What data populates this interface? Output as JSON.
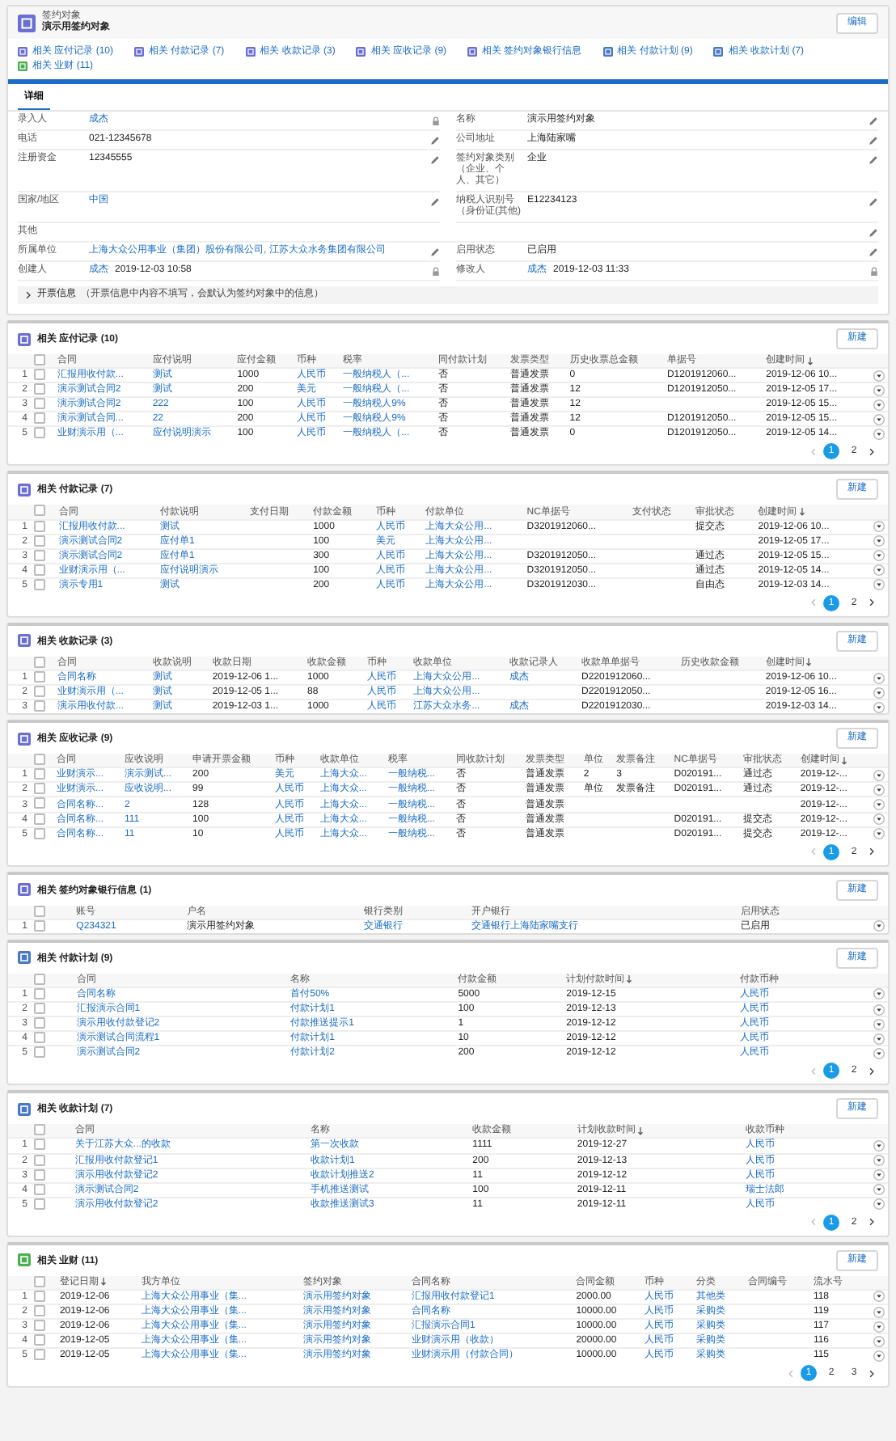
{
  "header": {
    "object_type": "签约对象",
    "title": "演示用签约对象",
    "edit_button": "编辑"
  },
  "related_links": [
    {
      "label": "相关 应付记录 (10)",
      "color": "#6b6fd4"
    },
    {
      "label": "相关 付款记录 (7)",
      "color": "#6b6fd4"
    },
    {
      "label": "相关 收款记录 (3)",
      "color": "#6b6fd4"
    },
    {
      "label": "相关 应收记录 (9)",
      "color": "#6b6fd4"
    },
    {
      "label": "相关 签约对象银行信息",
      "color": "#6b6fd4"
    },
    {
      "label": "相关 付款计划 (9)",
      "color": "#4a78c8"
    },
    {
      "label": "相关 收款计划 (7)",
      "color": "#4a78c8"
    },
    {
      "label": "相关 业财 (11)",
      "color": "#4caf50"
    }
  ],
  "tabs": [
    {
      "label": "详细",
      "selected": true
    }
  ],
  "fields": [
    {
      "label": "录入人",
      "value": "成杰",
      "kind": "link",
      "locked": true
    },
    {
      "label": "名称",
      "value": "演示用签约对象",
      "kind": "text",
      "locked": false
    },
    {
      "label": "电话",
      "value": "021-12345678",
      "kind": "text",
      "locked": false
    },
    {
      "label": "公司地址",
      "value": "上海陆家嘴",
      "kind": "text",
      "locked": false
    },
    {
      "label": "注册资金",
      "value": "12345555",
      "kind": "text",
      "locked": false
    },
    {
      "label": "签约对象类别（企业、个人、其它）",
      "value": "企业",
      "kind": "text",
      "locked": false
    },
    {
      "label": "国家/地区",
      "value": "中国",
      "kind": "link",
      "locked": false
    },
    {
      "label": "纳税人识别号（身份证(其他)",
      "value": "E12234123",
      "kind": "text",
      "locked": false
    },
    {
      "label": "其他",
      "kind": "wide",
      "locked": false
    },
    {
      "label": "所属单位",
      "value": "上海大众公用事业（集团）股份有限公司, 江苏大众水务集团有限公司",
      "kind": "link",
      "locked": false
    },
    {
      "label": "启用状态",
      "value": "已启用",
      "kind": "text",
      "locked": false
    },
    {
      "label": "创建人",
      "value": "成杰",
      "extra": "2019-12-03 10:58",
      "kind": "link",
      "locked": true
    },
    {
      "label": "修改人",
      "value": "成杰",
      "extra": "2019-12-03 11:33",
      "kind": "link",
      "locked": true
    }
  ],
  "collapsible": {
    "label": "开票信息",
    "note": "（开票信息中内容不填写，会默认为签约对象中的信息）",
    "expanded": false
  },
  "tables": [
    {
      "title": "相关 应付记录 (10)",
      "color": "#6b6fd4",
      "new_button": "新建",
      "select_all": false,
      "columns": [
        {
          "label": "合同",
          "link": true,
          "sorted": false
        },
        {
          "label": "应付说明",
          "link": true,
          "sorted": false
        },
        {
          "label": "应付金额",
          "link": false,
          "sorted": false
        },
        {
          "label": "币种",
          "link": true,
          "sorted": false
        },
        {
          "label": "税率",
          "link": true,
          "sorted": false
        },
        {
          "label": "同付款计划",
          "link": false,
          "sorted": false
        },
        {
          "label": "发票类型",
          "link": false,
          "sorted": false
        },
        {
          "label": "历史收票总金额",
          "link": false,
          "sorted": false
        },
        {
          "label": "单据号",
          "link": false,
          "sorted": false
        },
        {
          "label": "创建时间",
          "link": false,
          "sorted": true
        }
      ],
      "rows": [
        {
          "no": "1",
          "checked": false,
          "cells": [
            "汇报用收付款...",
            "测试",
            "1000",
            "人民币",
            "一般纳税人（...",
            "否",
            "普通发票",
            "0",
            "D1201912060...",
            "2019-12-06 10..."
          ]
        },
        {
          "no": "2",
          "checked": false,
          "cells": [
            "演示测试合同2",
            "测试",
            "200",
            "美元",
            "一般纳税人（...",
            "否",
            "普通发票",
            "12",
            "D1201912050...",
            "2019-12-05 17..."
          ]
        },
        {
          "no": "3",
          "checked": false,
          "cells": [
            "演示测试合同2",
            "222",
            "100",
            "人民币",
            "一般纳税人9%",
            "否",
            "普通发票",
            "12",
            null,
            "2019-12-05 15..."
          ]
        },
        {
          "no": "4",
          "checked": false,
          "cells": [
            "演示测试合同...",
            "22",
            "200",
            "人民币",
            "一般纳税人9%",
            "否",
            "普通发票",
            "12",
            "D1201912050...",
            "2019-12-05 15..."
          ]
        },
        {
          "no": "5",
          "checked": false,
          "cells": [
            "业财演示用（...",
            "应付说明演示",
            "100",
            "人民币",
            "一般纳税人（...",
            "否",
            "普通发票",
            "0",
            "D1201912050...",
            "2019-12-05 14..."
          ]
        }
      ],
      "pages": [
        {
          "label": "1",
          "selected": true
        },
        {
          "label": "2",
          "selected": false
        }
      ]
    },
    {
      "title": "相关 付款记录 (7)",
      "color": "#6b6fd4",
      "new_button": "新建",
      "select_all": false,
      "columns": [
        {
          "label": "合同",
          "link": true,
          "sorted": false
        },
        {
          "label": "付款说明",
          "link": true,
          "sorted": false
        },
        {
          "label": "支付日期",
          "sorted": false
        },
        {
          "label": "付款金额",
          "link": false,
          "sorted": false
        },
        {
          "label": "币种",
          "link": true,
          "sorted": false
        },
        {
          "label": "付款单位",
          "link": true,
          "sorted": false
        },
        {
          "label": "NC单据号",
          "link": false,
          "sorted": false
        },
        {
          "label": "支付状态",
          "sorted": false
        },
        {
          "label": "审批状态",
          "link": false,
          "sorted": false
        },
        {
          "label": "创建时间",
          "link": false,
          "sorted": true
        }
      ],
      "rows": [
        {
          "no": "1",
          "checked": false,
          "cells": [
            "汇报用收付款...",
            "测试",
            null,
            "1000",
            "人民币",
            "上海大众公用...",
            "D3201912060...",
            null,
            "提交态",
            "2019-12-06 10..."
          ]
        },
        {
          "no": "2",
          "checked": false,
          "cells": [
            "演示测试合同2",
            "应付单1",
            null,
            "100",
            "美元",
            "上海大众公用...",
            null,
            null,
            null,
            "2019-12-05 17..."
          ]
        },
        {
          "no": "3",
          "checked": false,
          "cells": [
            "演示测试合同2",
            "应付单1",
            null,
            "300",
            "人民币",
            "上海大众公用...",
            "D3201912050...",
            null,
            "通过态",
            "2019-12-05 15..."
          ]
        },
        {
          "no": "4",
          "checked": false,
          "cells": [
            "业财演示用（...",
            "应付说明演示",
            null,
            "100",
            "人民币",
            "上海大众公用...",
            "D3201912050...",
            null,
            "通过态",
            "2019-12-05 14..."
          ]
        },
        {
          "no": "5",
          "checked": false,
          "cells": [
            "演示专用1",
            "测试",
            null,
            "200",
            "人民币",
            "上海大众公用...",
            "D3201912030...",
            null,
            "自由态",
            "2019-12-03 14..."
          ]
        }
      ],
      "pages": [
        {
          "label": "1",
          "selected": true
        },
        {
          "label": "2",
          "selected": false
        }
      ]
    },
    {
      "title": "相关 收款记录 (3)",
      "color": "#6b6fd4",
      "new_button": "新建",
      "select_all": false,
      "columns": [
        {
          "label": "合同",
          "link": true,
          "sorted": false
        },
        {
          "label": "收款说明",
          "link": true,
          "sorted": false
        },
        {
          "label": "收款日期",
          "link": false,
          "sorted": false
        },
        {
          "label": "收款金额",
          "link": false,
          "sorted": false
        },
        {
          "label": "币种",
          "link": true,
          "sorted": false
        },
        {
          "label": "收款单位",
          "link": true,
          "sorted": false
        },
        {
          "label": "收款记录人",
          "link": true,
          "sorted": false
        },
        {
          "label": "收款单单据号",
          "link": false,
          "sorted": false
        },
        {
          "label": "历史收款金额",
          "sorted": false
        },
        {
          "label": "创建时间",
          "link": false,
          "sorted": true
        }
      ],
      "rows": [
        {
          "no": "1",
          "checked": false,
          "cells": [
            "合同名称",
            "测试",
            "2019-12-06 1...",
            "1000",
            "人民币",
            "上海大众公用...",
            "成杰",
            "D2201912060...",
            null,
            "2019-12-06 10..."
          ]
        },
        {
          "no": "2",
          "checked": false,
          "cells": [
            "业财演示用（...",
            "测试",
            "2019-12-05 1...",
            "88",
            "人民币",
            "上海大众公用...",
            null,
            "D2201912050...",
            null,
            "2019-12-05 16..."
          ]
        },
        {
          "no": "3",
          "checked": false,
          "cells": [
            "演示用收付款...",
            "测试",
            "2019-12-03 1...",
            "1000",
            "人民币",
            "江苏大众水务...",
            "成杰",
            "D2201912030...",
            null,
            "2019-12-03 14..."
          ]
        }
      ]
    },
    {
      "title": "相关 应收记录 (9)",
      "color": "#6b6fd4",
      "new_button": "新建",
      "select_all": false,
      "columns": [
        {
          "label": "合同",
          "link": true,
          "sorted": false
        },
        {
          "label": "应收说明",
          "link": true,
          "sorted": false
        },
        {
          "label": "申请开票金额",
          "link": false,
          "sorted": false
        },
        {
          "label": "币种",
          "link": true,
          "sorted": false
        },
        {
          "label": "收款单位",
          "link": true,
          "sorted": false
        },
        {
          "label": "税率",
          "link": true,
          "sorted": false
        },
        {
          "label": "同收款计划",
          "link": false,
          "sorted": false
        },
        {
          "label": "发票类型",
          "link": false,
          "sorted": false
        },
        {
          "label": "单位",
          "link": false,
          "sorted": false
        },
        {
          "label": "发票备注",
          "link": false,
          "sorted": false
        },
        {
          "label": "NC单据号",
          "link": false,
          "sorted": false
        },
        {
          "label": "审批状态",
          "link": false,
          "sorted": false
        },
        {
          "label": "创建时间",
          "link": false,
          "sorted": true
        }
      ],
      "rows": [
        {
          "no": "1",
          "checked": false,
          "cells": [
            "业财演示...",
            "演示测试...",
            "200",
            "美元",
            "上海大众...",
            "一般纳税...",
            "否",
            "普通发票",
            "2",
            "3",
            "D020191...",
            "通过态",
            "2019-12-..."
          ]
        },
        {
          "no": "2",
          "checked": false,
          "cells": [
            "业财演示...",
            "应收说明...",
            "99",
            "人民币",
            "上海大众...",
            "一般纳税...",
            "否",
            "普通发票",
            "单位",
            "发票备注",
            "D020191...",
            "通过态",
            "2019-12-..."
          ]
        },
        {
          "no": "3",
          "checked": false,
          "cells": [
            "合同名称...",
            "2",
            "128",
            "人民币",
            "上海大众...",
            "一般纳税...",
            "否",
            "普通发票",
            null,
            null,
            null,
            null,
            "2019-12-..."
          ]
        },
        {
          "no": "4",
          "checked": false,
          "cells": [
            "合同名称...",
            "111",
            "100",
            "人民币",
            "上海大众...",
            "一般纳税...",
            "否",
            "普通发票",
            null,
            null,
            "D020191...",
            "提交态",
            "2019-12-..."
          ]
        },
        {
          "no": "5",
          "checked": false,
          "cells": [
            "合同名称...",
            "11",
            "10",
            "人民币",
            "上海大众...",
            "一般纳税...",
            "否",
            "普通发票",
            null,
            null,
            "D020191...",
            "提交态",
            "2019-12-..."
          ]
        }
      ],
      "pages": [
        {
          "label": "1",
          "selected": true
        },
        {
          "label": "2",
          "selected": false
        }
      ]
    },
    {
      "title": "相关 签约对象银行信息 (1)",
      "color": "#6b6fd4",
      "new_button": "新建",
      "select_all": false,
      "columns": [
        {
          "label": "账号",
          "link": true,
          "sorted": false
        },
        {
          "label": "户名",
          "link": false,
          "sorted": false
        },
        {
          "label": "银行类别",
          "link": true,
          "sorted": false
        },
        {
          "label": "开户银行",
          "link": true,
          "sorted": false
        },
        {
          "label": "启用状态",
          "link": false,
          "sorted": false
        }
      ],
      "rows": [
        {
          "no": "1",
          "checked": false,
          "cells": [
            "Q234321",
            "演示用签约对象",
            "交通银行",
            "交通银行上海陆家嘴支行",
            "已启用"
          ]
        }
      ]
    },
    {
      "title": "相关 付款计划 (9)",
      "color": "#4a78c8",
      "new_button": "新建",
      "select_all": false,
      "columns": [
        {
          "label": "合同",
          "link": true,
          "sorted": false
        },
        {
          "label": "名称",
          "link": true,
          "sorted": false
        },
        {
          "label": "付款金额",
          "link": false,
          "sorted": false
        },
        {
          "label": "计划付款时间",
          "link": false,
          "sorted": true
        },
        {
          "label": "付款币种",
          "link": true,
          "sorted": false
        }
      ],
      "rows": [
        {
          "no": "1",
          "checked": false,
          "cells": [
            "合同名称",
            "首付50%",
            "5000",
            "2019-12-15",
            "人民币"
          ]
        },
        {
          "no": "2",
          "checked": false,
          "cells": [
            "汇报演示合同1",
            "付款计划1",
            "100",
            "2019-12-13",
            "人民币"
          ]
        },
        {
          "no": "3",
          "checked": false,
          "cells": [
            "演示用收付款登记2",
            "付款推送提示1",
            "1",
            "2019-12-12",
            "人民币"
          ]
        },
        {
          "no": "4",
          "checked": false,
          "cells": [
            "演示测试合同流程1",
            "付款计划1",
            "10",
            "2019-12-12",
            "人民币"
          ]
        },
        {
          "no": "5",
          "checked": false,
          "cells": [
            "演示测试合同2",
            "付款计划2",
            "200",
            "2019-12-12",
            "人民币"
          ]
        }
      ],
      "pages": [
        {
          "label": "1",
          "selected": true
        },
        {
          "label": "2",
          "selected": false
        }
      ]
    },
    {
      "title": "相关 收款计划 (7)",
      "color": "#4a78c8",
      "new_button": "新建",
      "select_all": false,
      "columns": [
        {
          "label": "合同",
          "link": true,
          "sorted": false
        },
        {
          "label": "名称",
          "link": true,
          "sorted": false
        },
        {
          "label": "收款金额",
          "link": false,
          "sorted": false
        },
        {
          "label": "计划收款时间",
          "link": false,
          "sorted": true
        },
        {
          "label": "收款币种",
          "link": true,
          "sorted": false
        }
      ],
      "rows": [
        {
          "no": "1",
          "checked": false,
          "cells": [
            "关于江苏大众...的收款",
            "第一次收款",
            "1111",
            "2019-12-27",
            "人民币"
          ]
        },
        {
          "no": "2",
          "checked": false,
          "cells": [
            "汇报用收付款登记1",
            "收款计划1",
            "200",
            "2019-12-13",
            "人民币"
          ]
        },
        {
          "no": "3",
          "checked": false,
          "cells": [
            "演示用收付款登记2",
            "收款计划推送2",
            "11",
            "2019-12-12",
            "人民币"
          ]
        },
        {
          "no": "4",
          "checked": false,
          "cells": [
            "演示测试合同2",
            "手机推送测试",
            "100",
            "2019-12-11",
            "瑞士法郎"
          ]
        },
        {
          "no": "5",
          "checked": false,
          "cells": [
            "演示用收付款登记2",
            "收款推送测试3",
            "11",
            "2019-12-11",
            "人民币"
          ]
        }
      ],
      "pages": [
        {
          "label": "1",
          "selected": true
        },
        {
          "label": "2",
          "selected": false
        }
      ]
    },
    {
      "title": "相关 业财 (11)",
      "color": "#4caf50",
      "new_button": "新建",
      "select_all": false,
      "columns": [
        {
          "label": "登记日期",
          "link": false,
          "sorted": true
        },
        {
          "label": "我方单位",
          "link": true,
          "sorted": false
        },
        {
          "label": "签约对象",
          "link": true,
          "sorted": false
        },
        {
          "label": "合同名称",
          "link": true,
          "sorted": false
        },
        {
          "label": "合同金额",
          "link": false,
          "sorted": false
        },
        {
          "label": "币种",
          "link": true,
          "sorted": false
        },
        {
          "label": "分类",
          "link": true,
          "sorted": false
        },
        {
          "label": "合同编号",
          "sorted": false
        },
        {
          "label": "流水号",
          "link": false,
          "sorted": false
        }
      ],
      "rows": [
        {
          "no": "1",
          "checked": false,
          "cells": [
            "2019-12-06",
            "上海大众公用事业（集...",
            "演示用签约对象",
            "汇报用收付款登记1",
            "2000.00",
            "人民币",
            "其他类",
            null,
            "118"
          ]
        },
        {
          "no": "2",
          "checked": false,
          "cells": [
            "2019-12-06",
            "上海大众公用事业（集...",
            "演示用签约对象",
            "合同名称",
            "10000.00",
            "人民币",
            "采购类",
            null,
            "119"
          ]
        },
        {
          "no": "3",
          "checked": false,
          "cells": [
            "2019-12-06",
            "上海大众公用事业（集...",
            "演示用签约对象",
            "汇报演示合同1",
            "10000.00",
            "人民币",
            "采购类",
            null,
            "117"
          ]
        },
        {
          "no": "4",
          "checked": false,
          "cells": [
            "2019-12-05",
            "上海大众公用事业（集...",
            "演示用签约对象",
            "业财演示用（收款）",
            "20000.00",
            "人民币",
            "采购类",
            null,
            "116"
          ]
        },
        {
          "no": "5",
          "checked": false,
          "cells": [
            "2019-12-05",
            "上海大众公用事业（集...",
            "演示用签约对象",
            "业财演示用（付款合同）",
            "10000.00",
            "人民币",
            "采购类",
            null,
            "115"
          ]
        }
      ],
      "pages": [
        {
          "label": "1",
          "selected": true
        },
        {
          "label": "2",
          "selected": false
        },
        {
          "label": "3",
          "selected": false
        }
      ]
    }
  ]
}
